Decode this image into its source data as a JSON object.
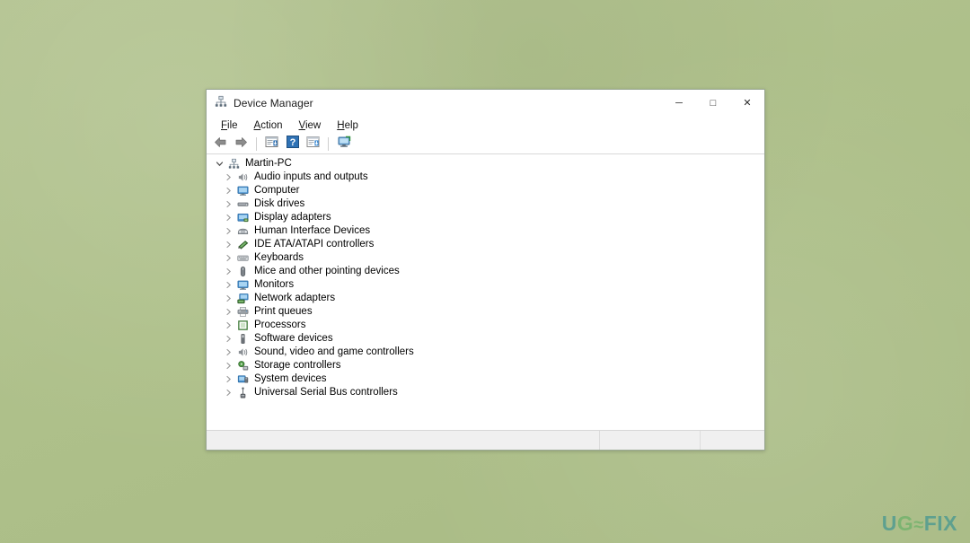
{
  "desktop": {
    "background_color": "#b0c18c"
  },
  "window": {
    "title": "Device Manager",
    "app_icon": "device-manager-icon",
    "caption_buttons": [
      {
        "name": "minimize",
        "glyph": "─"
      },
      {
        "name": "maximize",
        "glyph": "□"
      },
      {
        "name": "close",
        "glyph": "✕"
      }
    ]
  },
  "menubar": {
    "items": [
      {
        "accel": "F",
        "rest": "ile"
      },
      {
        "accel": "A",
        "rest": "ction"
      },
      {
        "accel": "V",
        "rest": "iew"
      },
      {
        "accel": "H",
        "rest": "elp"
      }
    ]
  },
  "toolbar": {
    "buttons": [
      {
        "name": "back-button",
        "icon": "back-arrow-icon"
      },
      {
        "name": "forward-button",
        "icon": "forward-arrow-icon"
      },
      {
        "name": "separator-1",
        "icon": "separator"
      },
      {
        "name": "properties-button",
        "icon": "properties-icon"
      },
      {
        "name": "help-button",
        "icon": "help-question-icon"
      },
      {
        "name": "update-driver-button",
        "icon": "update-driver-icon"
      },
      {
        "name": "separator-2",
        "icon": "separator"
      },
      {
        "name": "scan-hardware-changes-button",
        "icon": "scan-hardware-icon"
      }
    ]
  },
  "tree": {
    "root": {
      "label": "Martin-PC",
      "icon": "computer-node-icon",
      "expanded": true
    },
    "children": [
      {
        "label": "Audio inputs and outputs",
        "icon": "speaker-icon"
      },
      {
        "label": "Computer",
        "icon": "monitor-icon"
      },
      {
        "label": "Disk drives",
        "icon": "disk-drive-icon"
      },
      {
        "label": "Display adapters",
        "icon": "display-adapter-icon"
      },
      {
        "label": "Human Interface Devices",
        "icon": "hid-icon"
      },
      {
        "label": "IDE ATA/ATAPI controllers",
        "icon": "ide-controller-icon"
      },
      {
        "label": "Keyboards",
        "icon": "keyboard-icon"
      },
      {
        "label": "Mice and other pointing devices",
        "icon": "mouse-icon"
      },
      {
        "label": "Monitors",
        "icon": "monitor-icon"
      },
      {
        "label": "Network adapters",
        "icon": "network-adapter-icon"
      },
      {
        "label": "Print queues",
        "icon": "printer-icon"
      },
      {
        "label": "Processors",
        "icon": "processor-icon"
      },
      {
        "label": "Software devices",
        "icon": "software-device-icon"
      },
      {
        "label": "Sound, video and game controllers",
        "icon": "speaker-icon"
      },
      {
        "label": "Storage controllers",
        "icon": "storage-controller-icon"
      },
      {
        "label": "System devices",
        "icon": "system-device-icon"
      },
      {
        "label": "Universal Serial Bus controllers",
        "icon": "usb-icon"
      }
    ]
  },
  "statusbar": {
    "panes": [
      "",
      "",
      ""
    ]
  },
  "watermark": {
    "part_u": "U",
    "part_g": "G",
    "part_et": "≈",
    "part_fix": "FIX",
    "color_teal": "#2f8f93",
    "color_green": "#5fae62"
  }
}
